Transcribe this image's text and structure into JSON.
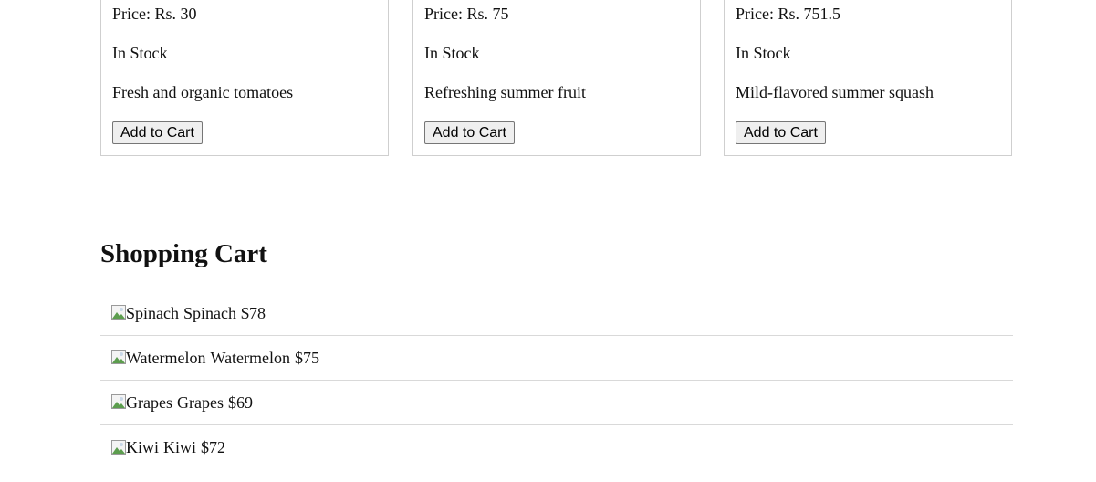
{
  "products": [
    {
      "price": "Price: Rs. 30",
      "stock": "In Stock",
      "description": "Fresh and organic tomatoes",
      "button": "Add to Cart"
    },
    {
      "price": "Price: Rs. 75",
      "stock": "In Stock",
      "description": "Refreshing summer fruit",
      "button": "Add to Cart"
    },
    {
      "price": "Price: Rs. 751.5",
      "stock": "In Stock",
      "description": "Mild-flavored summer squash",
      "button": "Add to Cart"
    }
  ],
  "cart": {
    "title": "Shopping Cart",
    "items": [
      {
        "alt": "Spinach",
        "name": "Spinach",
        "price": "$78",
        "image_icon": "broken-image-icon"
      },
      {
        "alt": "Watermelon",
        "name": "Watermelon",
        "price": "$75",
        "image_icon": "broken-image-icon"
      },
      {
        "alt": "Grapes",
        "name": "Grapes",
        "price": "$69",
        "image_icon": "broken-image-icon"
      },
      {
        "alt": "Kiwi",
        "name": "Kiwi",
        "price": "$72",
        "image_icon": "broken-image-icon"
      }
    ]
  }
}
